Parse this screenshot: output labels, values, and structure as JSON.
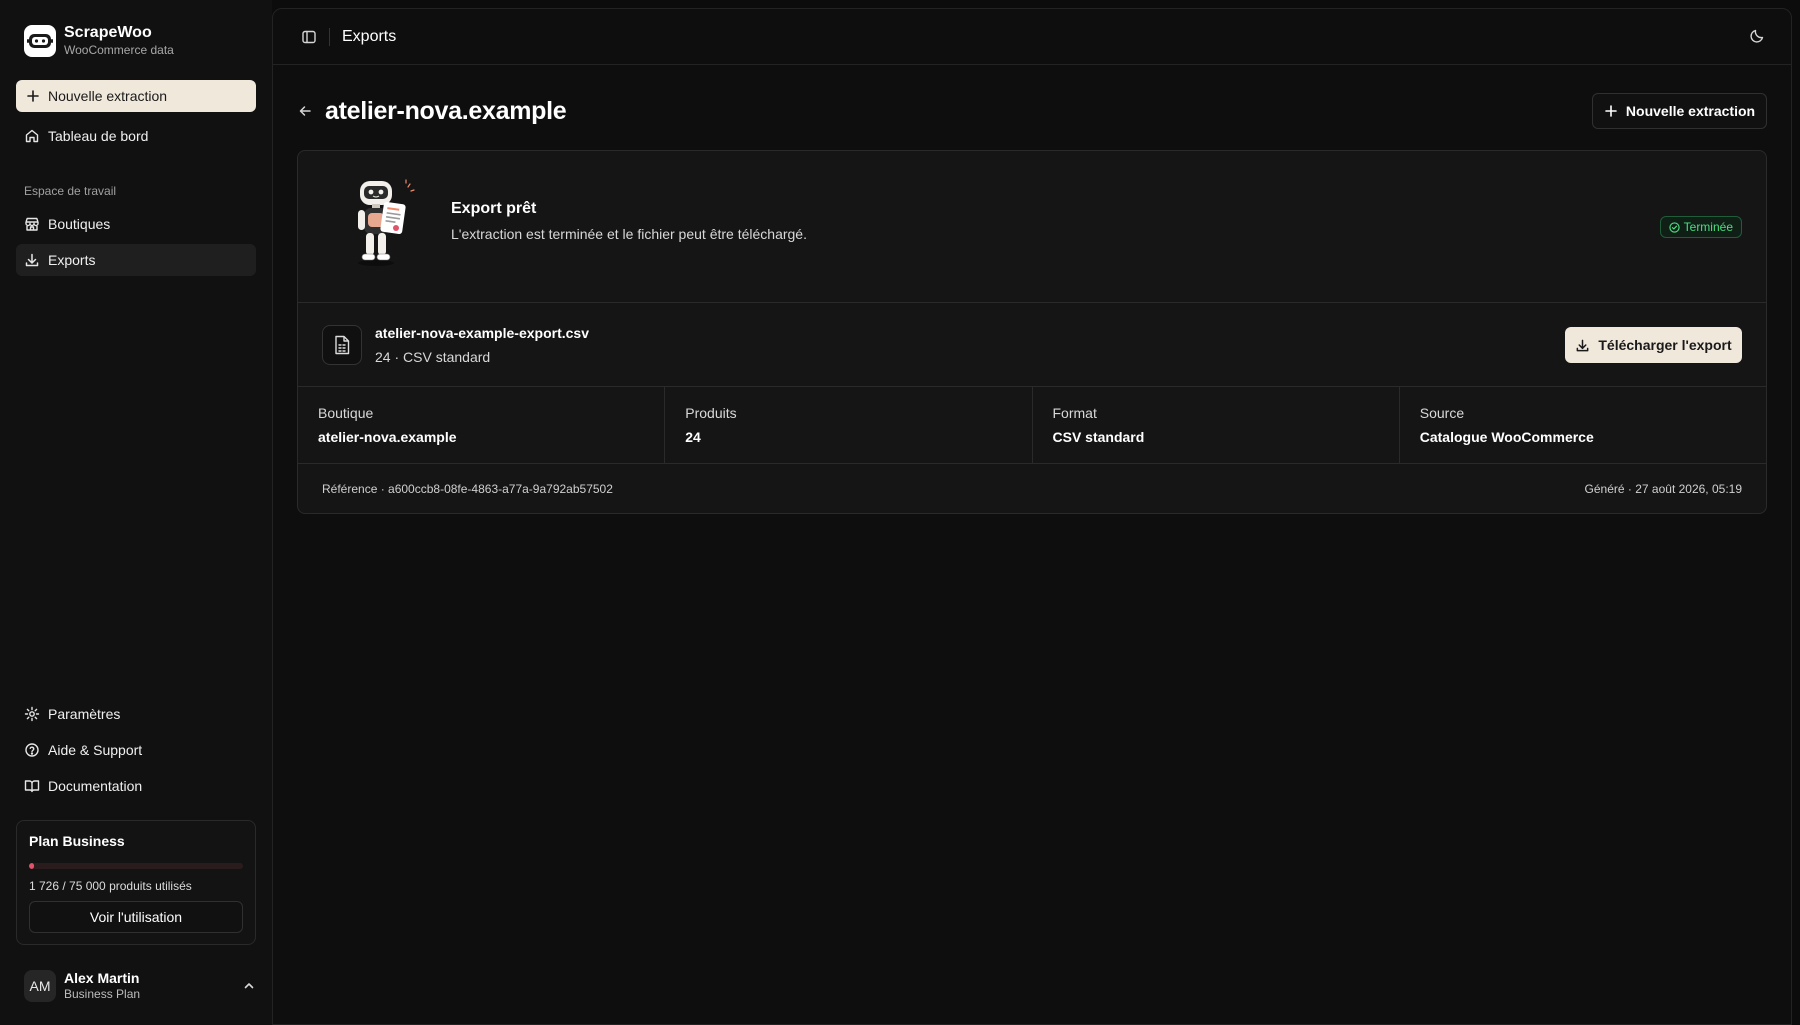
{
  "brand": {
    "name": "ScrapeWoo",
    "subtitle": "WooCommerce data"
  },
  "sidebar": {
    "new_extraction": "Nouvelle extraction",
    "dashboard": "Tableau de bord",
    "workspace_label": "Espace de travail",
    "shops": "Boutiques",
    "exports": "Exports",
    "settings": "Paramètres",
    "help": "Aide & Support",
    "docs": "Documentation"
  },
  "plan": {
    "title": "Plan Business",
    "used": 1726,
    "limit": 75000,
    "usage_text": "1 726 / 75 000 produits utilisés",
    "button": "Voir l'utilisation"
  },
  "user": {
    "initials": "AM",
    "name": "Alex Martin",
    "plan": "Business Plan"
  },
  "topbar": {
    "title": "Exports"
  },
  "page": {
    "title": "atelier-nova.example",
    "new_button": "Nouvelle extraction"
  },
  "export": {
    "ready_title": "Export prêt",
    "ready_desc": "L'extraction est terminée et le fichier peut être téléchargé.",
    "status": "Terminée",
    "file_name": "atelier-nova-example-export.csv",
    "file_meta": "24 · CSV standard",
    "download_button": "Télécharger l'export",
    "stats": [
      {
        "label": "Boutique",
        "value": "atelier-nova.example"
      },
      {
        "label": "Produits",
        "value": "24"
      },
      {
        "label": "Format",
        "value": "CSV standard"
      },
      {
        "label": "Source",
        "value": "Catalogue WooCommerce"
      }
    ],
    "reference": "Référence · a600ccb8-08fe-4863-a77a-9a792ab57502",
    "generated": "Généré · 27 août 2026, 05:19"
  },
  "colors": {
    "accent_button": "#f1e8dc",
    "status_green": "#4ade80",
    "progress": "#e0536b",
    "background": "#0c0c0c"
  },
  "icons": [
    "robot-logo-icon",
    "plus-icon",
    "home-icon",
    "store-icon",
    "download-icon",
    "gear-icon",
    "help-circle-icon",
    "book-icon",
    "chevron-up-icon",
    "sidebar-toggle-icon",
    "moon-icon",
    "arrow-left-icon",
    "check-circle-icon",
    "file-spreadsheet-icon"
  ]
}
